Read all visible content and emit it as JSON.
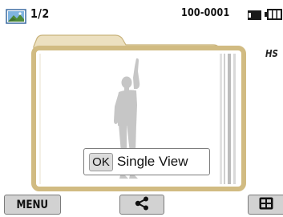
{
  "status_bar": {
    "counter": "1/2",
    "file_number": "100-0001",
    "playback_icon": "playback-photo-icon",
    "card_icon": "memory-card-icon",
    "battery_icon": "battery-full-icon"
  },
  "preview": {
    "side_label": "HS",
    "folder_icon": "folder-icon",
    "silhouette": "person-silhouette"
  },
  "single_view": {
    "key": "OK",
    "label": "Single View"
  },
  "bottom_bar": {
    "menu_label": "MENU",
    "share_icon": "share-icon",
    "thumbnail_icon": "thumbnail-view-icon"
  },
  "colors": {
    "folder_border": "#d3bf8a",
    "folder_tab": "#e9dcb8",
    "button_bg": "#d2d2d2",
    "silhouette": "#c6c6c6"
  }
}
